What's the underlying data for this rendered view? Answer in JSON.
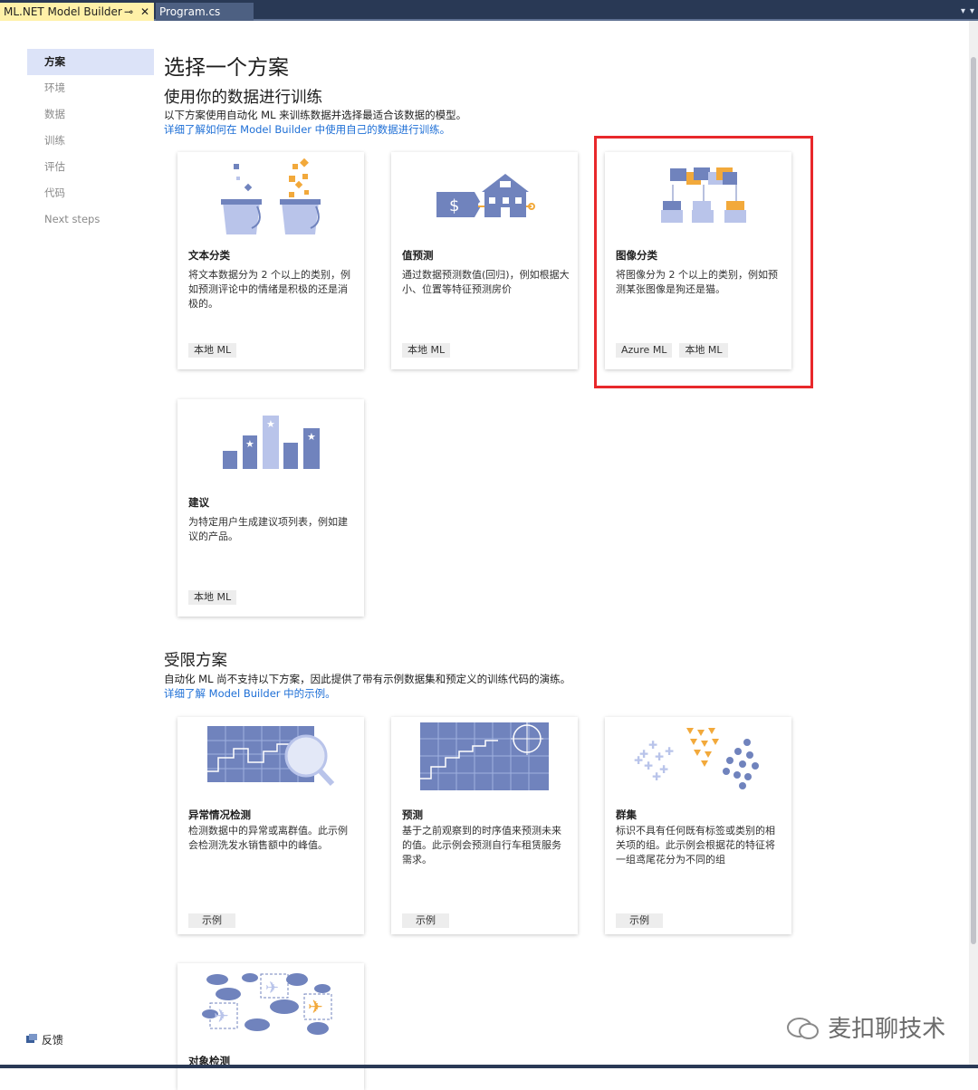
{
  "tabs": [
    {
      "label": "ML.NET Model Builder",
      "pin": "⊸",
      "close": "✕"
    },
    {
      "label": "Program.cs"
    }
  ],
  "sidebar": {
    "items": [
      "方案",
      "环境",
      "数据",
      "训练",
      "评估",
      "代码",
      "Next steps"
    ],
    "feedback": "反馈"
  },
  "main": {
    "title": "选择一个方案",
    "section1": {
      "heading": "使用你的数据进行训练",
      "description": "以下方案使用自动化 ML 来训练数据并选择最适合该数据的模型。",
      "link": "详细了解如何在 Model Builder 中使用自己的数据进行训练。"
    },
    "cards": [
      {
        "title": "文本分类",
        "desc": "将文本数据分为 2 个以上的类别，例如预测评论中的情绪是积极的还是消极的。",
        "tags": [
          "本地 ML"
        ]
      },
      {
        "title": "值预测",
        "desc": "通过数据预测数值(回归)，例如根据大小、位置等特征预测房价",
        "tags": [
          "本地 ML"
        ]
      },
      {
        "title": "图像分类",
        "desc": "将图像分为 2 个以上的类别，例如预测某张图像是狗还是猫。",
        "tags": [
          "Azure ML",
          "本地 ML"
        ]
      },
      {
        "title": "建议",
        "desc": "为特定用户生成建议项列表，例如建议的产品。",
        "tags": [
          "本地 ML"
        ]
      }
    ],
    "section2": {
      "heading": "受限方案",
      "description": "自动化 ML 尚不支持以下方案，因此提供了带有示例数据集和预定义的训练代码的演练。",
      "link": "详细了解 Model Builder 中的示例。"
    },
    "limited_cards": [
      {
        "title": "异常情况检测",
        "desc": "检测数据中的异常或离群值。此示例会检测洗发水销售额中的峰值。",
        "tags": [
          "示例"
        ]
      },
      {
        "title": "预测",
        "desc": "基于之前观察到的时序值来预测未来的值。此示例会预测自行车租赁服务需求。",
        "tags": [
          "示例"
        ]
      },
      {
        "title": "群集",
        "desc": "标识不具有任何既有标签或类别的相关项的组。此示例会根据花的特征将一组鸢尾花分为不同的组",
        "tags": [
          "示例"
        ]
      },
      {
        "title": "对象检测",
        "desc": "",
        "tags": []
      }
    ]
  },
  "watermark": "麦扣聊技术",
  "colors": {
    "accent": "#7083bd",
    "light": "#b9c4ea",
    "orange": "#f2a93b",
    "link": "#1e6fd6",
    "highlight": "#e8282b",
    "tab_bg": "#293955"
  }
}
